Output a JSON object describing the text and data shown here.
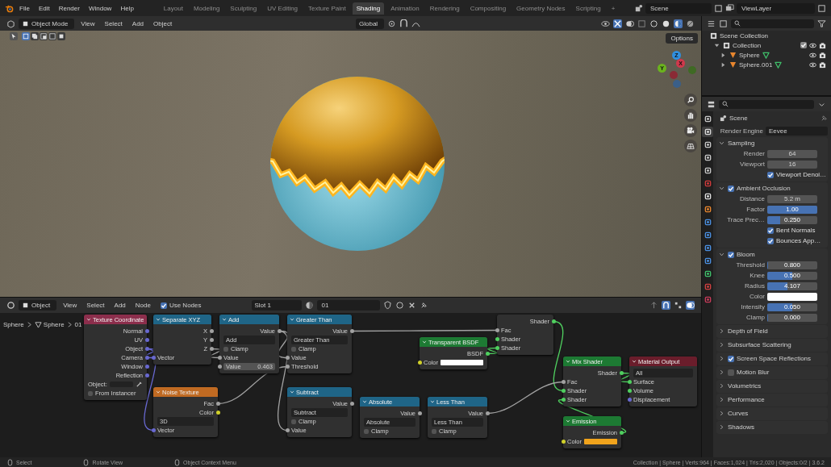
{
  "topbar": {
    "menus": [
      "File",
      "Edit",
      "Render",
      "Window",
      "Help"
    ],
    "workspaces": [
      {
        "label": "Layout",
        "selected": false
      },
      {
        "label": "Modeling",
        "selected": false
      },
      {
        "label": "Sculpting",
        "selected": false
      },
      {
        "label": "UV Editing",
        "selected": false
      },
      {
        "label": "Texture Paint",
        "selected": false
      },
      {
        "label": "Shading",
        "selected": true
      },
      {
        "label": "Animation",
        "selected": false
      },
      {
        "label": "Rendering",
        "selected": false
      },
      {
        "label": "Compositing",
        "selected": false
      },
      {
        "label": "Geometry Nodes",
        "selected": false
      },
      {
        "label": "Scripting",
        "selected": false
      }
    ],
    "add_workspace": "+",
    "scene": "Scene",
    "view_layer": "ViewLayer"
  },
  "viewport": {
    "mode": "Object Mode",
    "menus": [
      "View",
      "Select",
      "Add",
      "Object"
    ],
    "orientation": "Global",
    "shading": [
      {
        "kind": "wireframe",
        "selected": false
      },
      {
        "kind": "solid",
        "selected": false
      },
      {
        "kind": "material",
        "selected": true
      },
      {
        "kind": "rendered",
        "selected": false
      }
    ],
    "options": "Options",
    "gizmo_axes": [
      {
        "label": "Z",
        "color": "#2f8fe0"
      },
      {
        "label": "X",
        "color": "#d0384c"
      },
      {
        "label": "Y",
        "color": "#6bb31e"
      }
    ]
  },
  "node_editor": {
    "mode": "Object",
    "menus": [
      "View",
      "Select",
      "Add",
      "Node"
    ],
    "use_nodes": {
      "label": "Use Nodes",
      "checked": true
    },
    "slot": "Slot 1",
    "material": "01",
    "breadcrumbs": [
      "Sphere",
      "Sphere",
      "01"
    ],
    "nodes": [
      {
        "title": "Texture Coordinate",
        "color": "#8c2e4c",
        "rows": [
          {
            "kind": "out",
            "label": "Normal",
            "socket": {
              "color": "#6868d0"
            }
          },
          {
            "kind": "out",
            "label": "UV",
            "socket": {
              "color": "#6868d0"
            }
          },
          {
            "kind": "out",
            "label": "Object",
            "socket": {
              "color": "#6868d0"
            }
          },
          {
            "kind": "out",
            "label": "Camera",
            "socket": {
              "color": "#6868d0"
            }
          },
          {
            "kind": "out",
            "label": "Window",
            "socket": {
              "color": "#6868d0"
            }
          },
          {
            "kind": "out",
            "label": "Reflection",
            "socket": {
              "color": "#6868d0"
            }
          },
          {
            "kind": "object_field",
            "label": "Object:"
          },
          {
            "kind": "check",
            "label": "From Instancer",
            "checked": false
          }
        ]
      },
      {
        "title": "Separate XYZ",
        "color": "#1f6587",
        "rows": [
          {
            "kind": "out",
            "label": "X",
            "socket": {
              "color": "#a1a1a1"
            }
          },
          {
            "kind": "out",
            "label": "Y",
            "socket": {
              "color": "#a1a1a1"
            }
          },
          {
            "kind": "out",
            "label": "Z",
            "socket": {
              "color": "#a1a1a1"
            }
          },
          {
            "kind": "in",
            "label": "Vector",
            "socket": {
              "color": "#6868d0"
            }
          }
        ]
      },
      {
        "title": "Add",
        "color": "#1f6587",
        "rows": [
          {
            "kind": "out",
            "label": "Value",
            "socket": {
              "color": "#a1a1a1"
            }
          },
          {
            "kind": "dropdown",
            "label": "Add"
          },
          {
            "kind": "check",
            "label": "Clamp",
            "checked": false
          },
          {
            "kind": "in",
            "label": "Value",
            "socket": {
              "color": "#a1a1a1"
            }
          },
          {
            "kind": "field",
            "label": "Value",
            "value": "0.463",
            "socket": {
              "color": "#a1a1a1"
            }
          }
        ]
      },
      {
        "title": "Greater Than",
        "color": "#1f6587",
        "rows": [
          {
            "kind": "out",
            "label": "Value",
            "socket": {
              "color": "#a1a1a1"
            }
          },
          {
            "kind": "dropdown",
            "label": "Greater Than"
          },
          {
            "kind": "check",
            "label": "Clamp",
            "checked": false
          },
          {
            "kind": "in",
            "label": "Value",
            "socket": {
              "color": "#a1a1a1"
            }
          },
          {
            "kind": "in",
            "label": "Threshold",
            "socket": {
              "color": "#a1a1a1"
            }
          }
        ]
      },
      {
        "title": "Noise Texture",
        "color": "#c06a22",
        "rows": [
          {
            "kind": "out",
            "label": "Fac",
            "socket": {
              "color": "#a1a1a1"
            }
          },
          {
            "kind": "out",
            "label": "Color",
            "socket": {
              "color": "#d0d02a"
            }
          },
          {
            "kind": "dropdown",
            "label": "3D"
          },
          {
            "kind": "in",
            "label": "Vector",
            "socket": {
              "color": "#6868d0"
            }
          }
        ]
      },
      {
        "title": "Subtract",
        "color": "#1f6587",
        "rows": [
          {
            "kind": "out",
            "label": "Value",
            "socket": {
              "color": "#a1a1a1"
            }
          },
          {
            "kind": "dropdown",
            "label": "Subtract"
          },
          {
            "kind": "check",
            "label": "Clamp",
            "checked": false
          },
          {
            "kind": "in",
            "label": "Value",
            "socket": {
              "color": "#a1a1a1"
            }
          }
        ]
      },
      {
        "title": "Absolute",
        "color": "#1f6587",
        "rows": [
          {
            "kind": "out",
            "label": "Value",
            "socket": {
              "color": "#a1a1a1"
            }
          },
          {
            "kind": "dropdown",
            "label": "Absolute"
          },
          {
            "kind": "check",
            "label": "Clamp",
            "checked": false
          }
        ]
      },
      {
        "title": "Less Than",
        "color": "#1f6587",
        "rows": [
          {
            "kind": "out",
            "label": "Value",
            "socket": {
              "color": "#a1a1a1"
            }
          },
          {
            "kind": "dropdown",
            "label": "Less Than"
          },
          {
            "kind": "check",
            "label": "Clamp",
            "checked": false
          }
        ]
      },
      {
        "rows": [
          {
            "kind": "out",
            "label": "Shader",
            "socket": {
              "color": "#4fcf5f"
            }
          },
          {
            "kind": "in",
            "label": "Fac",
            "socket": {
              "color": "#a1a1a1"
            }
          },
          {
            "kind": "in",
            "label": "Shader",
            "socket": {
              "color": "#4fcf5f"
            }
          },
          {
            "kind": "in",
            "label": "Shader",
            "socket": {
              "color": "#4fcf5f"
            }
          }
        ]
      },
      {
        "title": "Transparent BSDF",
        "color": "#1d7a33",
        "rows": [
          {
            "kind": "out",
            "label": "BSDF",
            "socket": {
              "color": "#4fcf5f"
            }
          },
          {
            "kind": "color",
            "label": "Color",
            "socket": {
              "color": "#d0d02a"
            },
            "color": "#ffffff"
          }
        ]
      },
      {
        "title": "Mix Shader",
        "color": "#1d7a33",
        "rows": [
          {
            "kind": "out",
            "label": "Shader",
            "socket": {
              "color": "#4fcf5f"
            }
          },
          {
            "kind": "in",
            "label": "Fac",
            "socket": {
              "color": "#a1a1a1"
            }
          },
          {
            "kind": "in",
            "label": "Shader",
            "socket": {
              "color": "#4fcf5f"
            }
          },
          {
            "kind": "in",
            "label": "Shader",
            "socket": {
              "color": "#4fcf5f"
            }
          }
        ]
      },
      {
        "title": "Material Output",
        "color": "#6a1d2b",
        "rows": [
          {
            "kind": "dropdown",
            "label": "All"
          },
          {
            "kind": "in",
            "label": "Surface",
            "socket": {
              "color": "#4fcf5f"
            }
          },
          {
            "kind": "in",
            "label": "Volume",
            "socket": {
              "color": "#4fcf5f"
            }
          },
          {
            "kind": "in",
            "label": "Displacement",
            "socket": {
              "color": "#6868d0"
            }
          }
        ]
      },
      {
        "title": "Emission",
        "color": "#1d7a33",
        "rows": [
          {
            "kind": "out",
            "label": "Emission",
            "socket": {
              "color": "#4fcf5f"
            }
          },
          {
            "kind": "color",
            "label": "Color",
            "socket": {
              "color": "#d0d02a"
            },
            "color": "#f0a31c"
          }
        ]
      }
    ]
  },
  "outliner": {
    "root": {
      "label": "Scene Collection",
      "children": [
        {
          "label": "Collection",
          "expanded": true,
          "checked": true,
          "children": [
            {
              "label": "Sphere",
              "expanded": false
            },
            {
              "label": "Sphere.001",
              "expanded": false
            }
          ]
        }
      ]
    }
  },
  "properties": {
    "tabs": [
      {
        "kind": "tool",
        "selected": false
      },
      {
        "kind": "render",
        "selected": true
      },
      {
        "kind": "output",
        "selected": false
      },
      {
        "kind": "view_layer",
        "selected": false
      },
      {
        "kind": "scene",
        "selected": false
      },
      {
        "kind": "world",
        "selected": false
      },
      {
        "kind": "collection",
        "selected": false
      },
      {
        "kind": "object",
        "selected": false
      },
      {
        "kind": "modifier",
        "selected": false
      },
      {
        "kind": "particles",
        "selected": false
      },
      {
        "kind": "physics",
        "selected": false
      },
      {
        "kind": "constraints",
        "selected": false
      },
      {
        "kind": "data",
        "selected": false
      },
      {
        "kind": "material",
        "selected": false
      },
      {
        "kind": "texture",
        "selected": false
      }
    ],
    "title": "Scene",
    "render_engine": {
      "label": "Render Engine",
      "value": "Eevee"
    },
    "panels": [
      {
        "title": "Sampling",
        "expanded": true,
        "rows": [
          {
            "kind": "number",
            "label": "Render",
            "value": "64"
          },
          {
            "kind": "number",
            "label": "Viewport",
            "value": "16"
          },
          {
            "kind": "check",
            "label": "Viewport Denoi…",
            "checked": true
          }
        ]
      },
      {
        "title": "Ambient Occlusion",
        "expanded": true,
        "enabled": true,
        "rows": [
          {
            "kind": "number",
            "label": "Distance",
            "value": "5.2 m"
          },
          {
            "kind": "slider",
            "label": "Factor",
            "value": "1.00",
            "level": 1
          },
          {
            "kind": "slider",
            "label": "Trace Prec…",
            "value": "0.250",
            "level": 0.25
          },
          {
            "kind": "check",
            "label": "Bent Normals",
            "checked": true
          },
          {
            "kind": "check",
            "label": "Bounces App…",
            "checked": true
          }
        ]
      },
      {
        "title": "Bloom",
        "expanded": true,
        "enabled": true,
        "rows": [
          {
            "kind": "slider",
            "label": "Threshold",
            "value": "0.800",
            "level": 0.02
          },
          {
            "kind": "slider",
            "label": "Knee",
            "value": "0.500",
            "level": 0.5
          },
          {
            "kind": "slider",
            "label": "Radius",
            "value": "4.107",
            "level": 0.4
          },
          {
            "kind": "color",
            "label": "Color",
            "color": "#ffffff"
          },
          {
            "kind": "slider",
            "label": "Intensity",
            "value": "0.050",
            "level": 0.5
          },
          {
            "kind": "slider",
            "label": "Clamp",
            "value": "0.000",
            "level": 0
          }
        ]
      },
      {
        "title": "Depth of Field",
        "expanded": false
      },
      {
        "title": "Subsurface Scattering",
        "expanded": false
      },
      {
        "title": "Screen Space Reflections",
        "expanded": false,
        "enabled": true
      },
      {
        "title": "Motion Blur",
        "expanded": false,
        "enabled": false
      },
      {
        "title": "Volumetrics",
        "expanded": false
      },
      {
        "title": "Performance",
        "expanded": false
      },
      {
        "title": "Curves",
        "expanded": false
      },
      {
        "title": "Shadows",
        "expanded": false
      }
    ]
  },
  "status_bar": {
    "items": [
      "Select",
      "Rotate View",
      "Object Context Menu"
    ],
    "stats": "Collection | Sphere | Verts:964 | Faces:1,024 | Tris:2,020 | Objects:0/2 | 3.6.2"
  }
}
